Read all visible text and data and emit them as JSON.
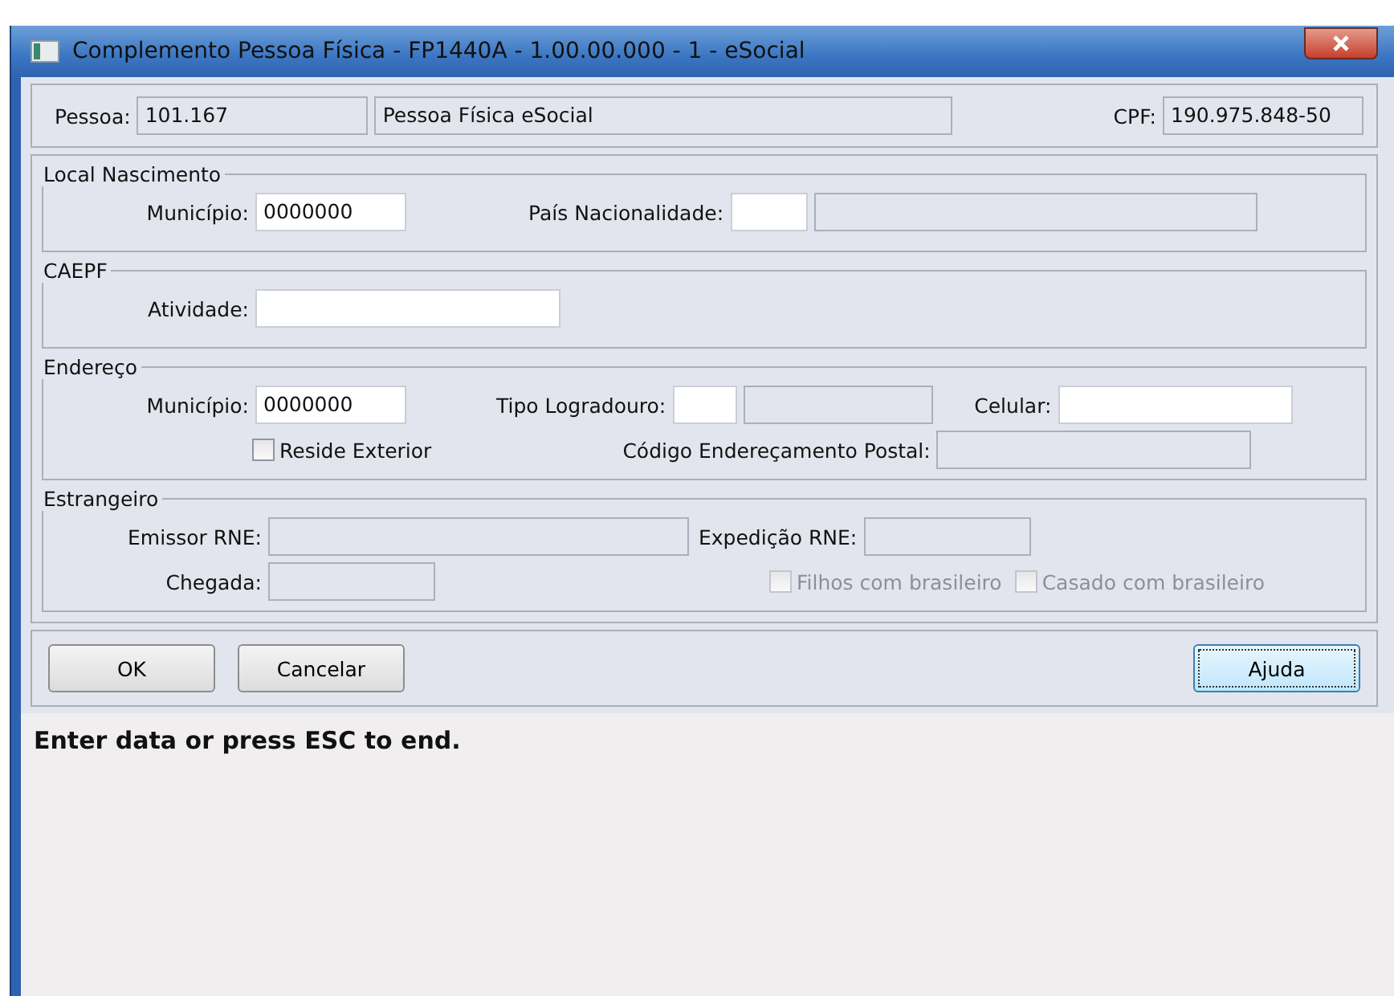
{
  "window": {
    "title": "Complemento Pessoa Física - FP1440A - 1.00.00.000 - 1 - eSocial"
  },
  "person": {
    "pessoa_label": "Pessoa:",
    "pessoa_code": "101.167",
    "pessoa_name": "Pessoa Física eSocial",
    "cpf_label": "CPF:",
    "cpf": "190.975.848-50"
  },
  "local_nascimento": {
    "title": "Local Nascimento",
    "municipio": {
      "label": "Município:",
      "value": "0000000",
      "disabled": false
    },
    "pais": {
      "label": "País Nacionalidade:",
      "disabled": false
    },
    "pais_desc": {
      "disabled": true
    }
  },
  "caepf": {
    "title": "CAEPF",
    "atividade": {
      "label": "Atividade:",
      "disabled": false
    }
  },
  "endereco": {
    "title": "Endereço",
    "municipio": {
      "label": "Município:",
      "value": "0000000",
      "disabled": false
    },
    "tipo": {
      "label": "Tipo Logradouro:",
      "disabled": false
    },
    "tipo_desc": {
      "disabled": true
    },
    "celular": {
      "label": "Celular:",
      "disabled": false
    },
    "reside": {
      "label": "Reside Exterior",
      "checked": false,
      "disabled": false
    },
    "cep": {
      "label": "Código Endereçamento Postal:",
      "disabled": true
    }
  },
  "estrangeiro": {
    "title": "Estrangeiro",
    "emissor": {
      "label": "Emissor RNE:",
      "disabled": true
    },
    "expedicao": {
      "label": "Expedição RNE:",
      "disabled": true
    },
    "chegada": {
      "label": "Chegada:",
      "disabled": true
    },
    "filhos": {
      "label": "Filhos com brasileiro",
      "checked": false,
      "disabled": true
    },
    "casado": {
      "label": "Casado com brasileiro",
      "checked": false,
      "disabled": true
    }
  },
  "buttons": [
    {
      "label": "OK",
      "focused": false
    },
    {
      "label": "Cancelar",
      "focused": false
    },
    {
      "label": "Ajuda",
      "focused": true
    }
  ],
  "status_bar": "Enter data or press ESC to end."
}
